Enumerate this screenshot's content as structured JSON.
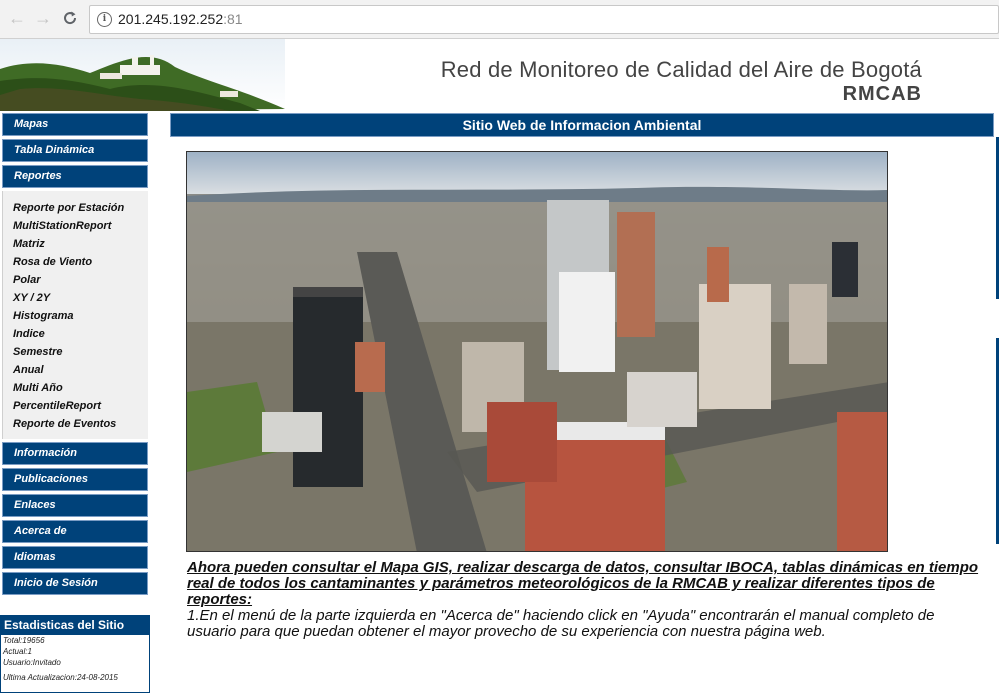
{
  "browser": {
    "url_host": "201.245.192.252",
    "url_port": ":81",
    "back_icon": "arrow-left-icon",
    "forward_icon": "arrow-right-icon",
    "reload_icon": "reload-icon",
    "info_icon": "info-icon"
  },
  "header": {
    "title": "Red de Monitoreo de Calidad del Aire de Bogotá",
    "acronym": "RMCAB"
  },
  "sidebar": {
    "menu": [
      {
        "label": "Mapas"
      },
      {
        "label": "Tabla Dinámica"
      },
      {
        "label": "Reportes"
      }
    ],
    "reportes_items": [
      "Reporte por Estación",
      "MultiStationReport",
      "Matriz",
      "Rosa de Viento",
      "Polar",
      "XY / 2Y",
      "Histograma",
      "Indice",
      "Semestre",
      "Anual",
      "Multi Año",
      "PercentileReport",
      "Reporte de Eventos"
    ],
    "menu_bottom": [
      {
        "label": "Información"
      },
      {
        "label": "Publicaciones"
      },
      {
        "label": "Enlaces"
      },
      {
        "label": "Acerca de"
      },
      {
        "label": "Idiomas"
      },
      {
        "label": "Inicio de Sesión"
      }
    ]
  },
  "stats": {
    "title": "Estadisticas del Sitio",
    "total": "Total:19656",
    "actual": "Actual:1",
    "usuario": "Usuario:Invitado",
    "ultima": "Ultima Actualizacion:24-08-2015"
  },
  "main": {
    "bar_title": "Sitio Web de Informacion Ambiental",
    "lead_text": "Ahora pueden consultar el Mapa GIS, realizar descarga de datos, consultar IBOCA, tablas dinámicas en tiempo real de todos los cantaminantes y parámetros meteorológicos de la RMCAB y realizar diferentes tipos de reportes:",
    "body_text": "1.En el menú de la parte izquierda en \"Acerca de\" haciendo click en \"Ayuda\" encontrarán el manual completo de usuario para que puedan obtener el mayor provecho de su experiencia con nuestra página web."
  },
  "colors": {
    "brand_blue": "#00427a",
    "menu_border": "#7a9cc4"
  }
}
